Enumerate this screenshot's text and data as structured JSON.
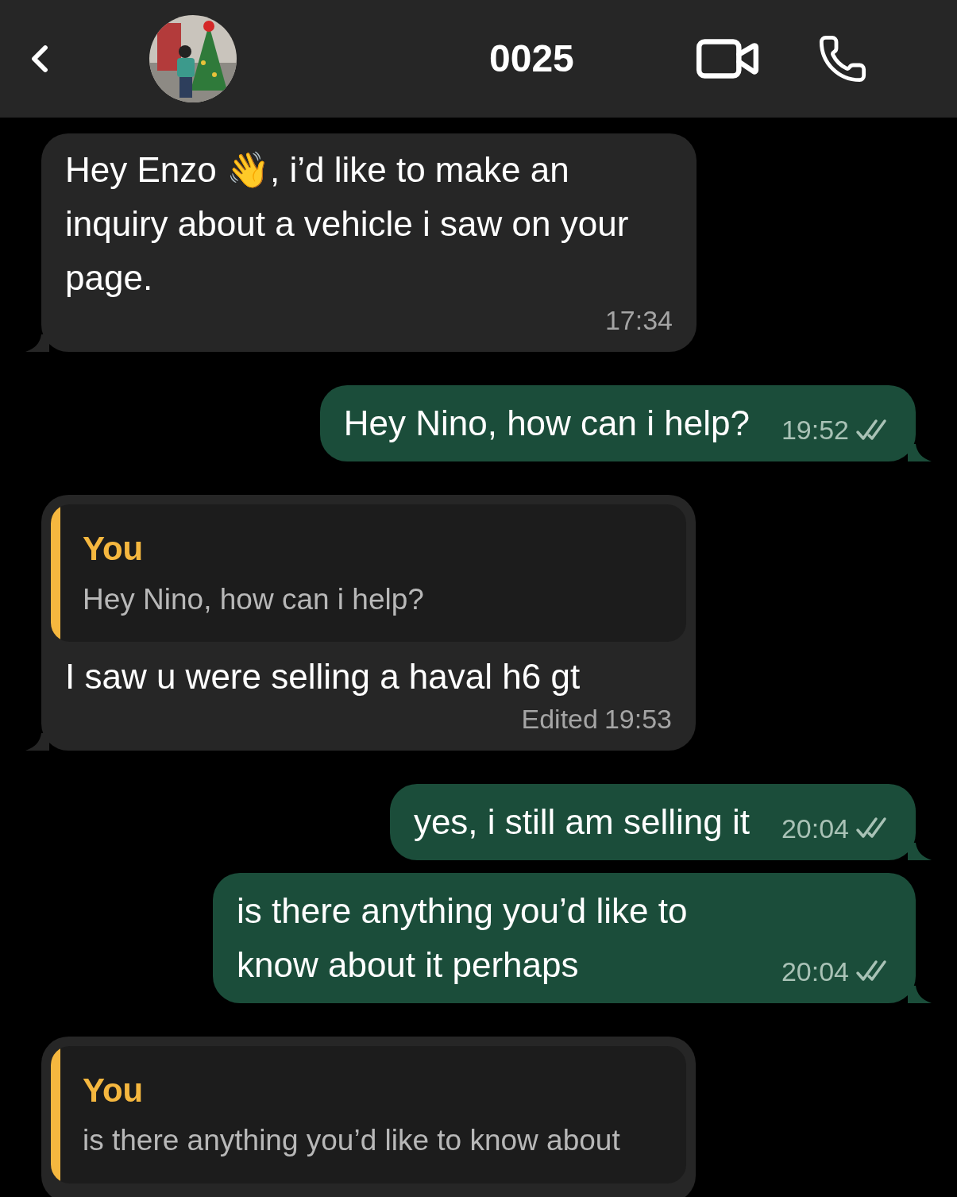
{
  "header": {
    "title": "0025"
  },
  "messages": [
    {
      "kind": "incoming",
      "text": "Hey Enzo 👋, i’d like to make an inquiry about a vehicle i saw on your page.",
      "time": "17:34"
    },
    {
      "kind": "outgoing",
      "text": "Hey Nino, how can i help?",
      "time": "19:52",
      "read": false
    },
    {
      "kind": "incoming",
      "reply": {
        "author": "You",
        "text": "Hey Nino, how can i help?"
      },
      "text": "I saw u were selling a haval h6 gt",
      "edited": "Edited",
      "time": "19:53"
    },
    {
      "kind": "outgoing",
      "text": "yes, i still am selling it",
      "time": "20:04",
      "read": false
    },
    {
      "kind": "outgoing",
      "text": "is there anything you’d like to know about it perhaps",
      "time": "20:04",
      "read": false
    },
    {
      "kind": "incoming",
      "reply": {
        "author": "You",
        "text": "is there anything you’d like to know about"
      }
    }
  ]
}
